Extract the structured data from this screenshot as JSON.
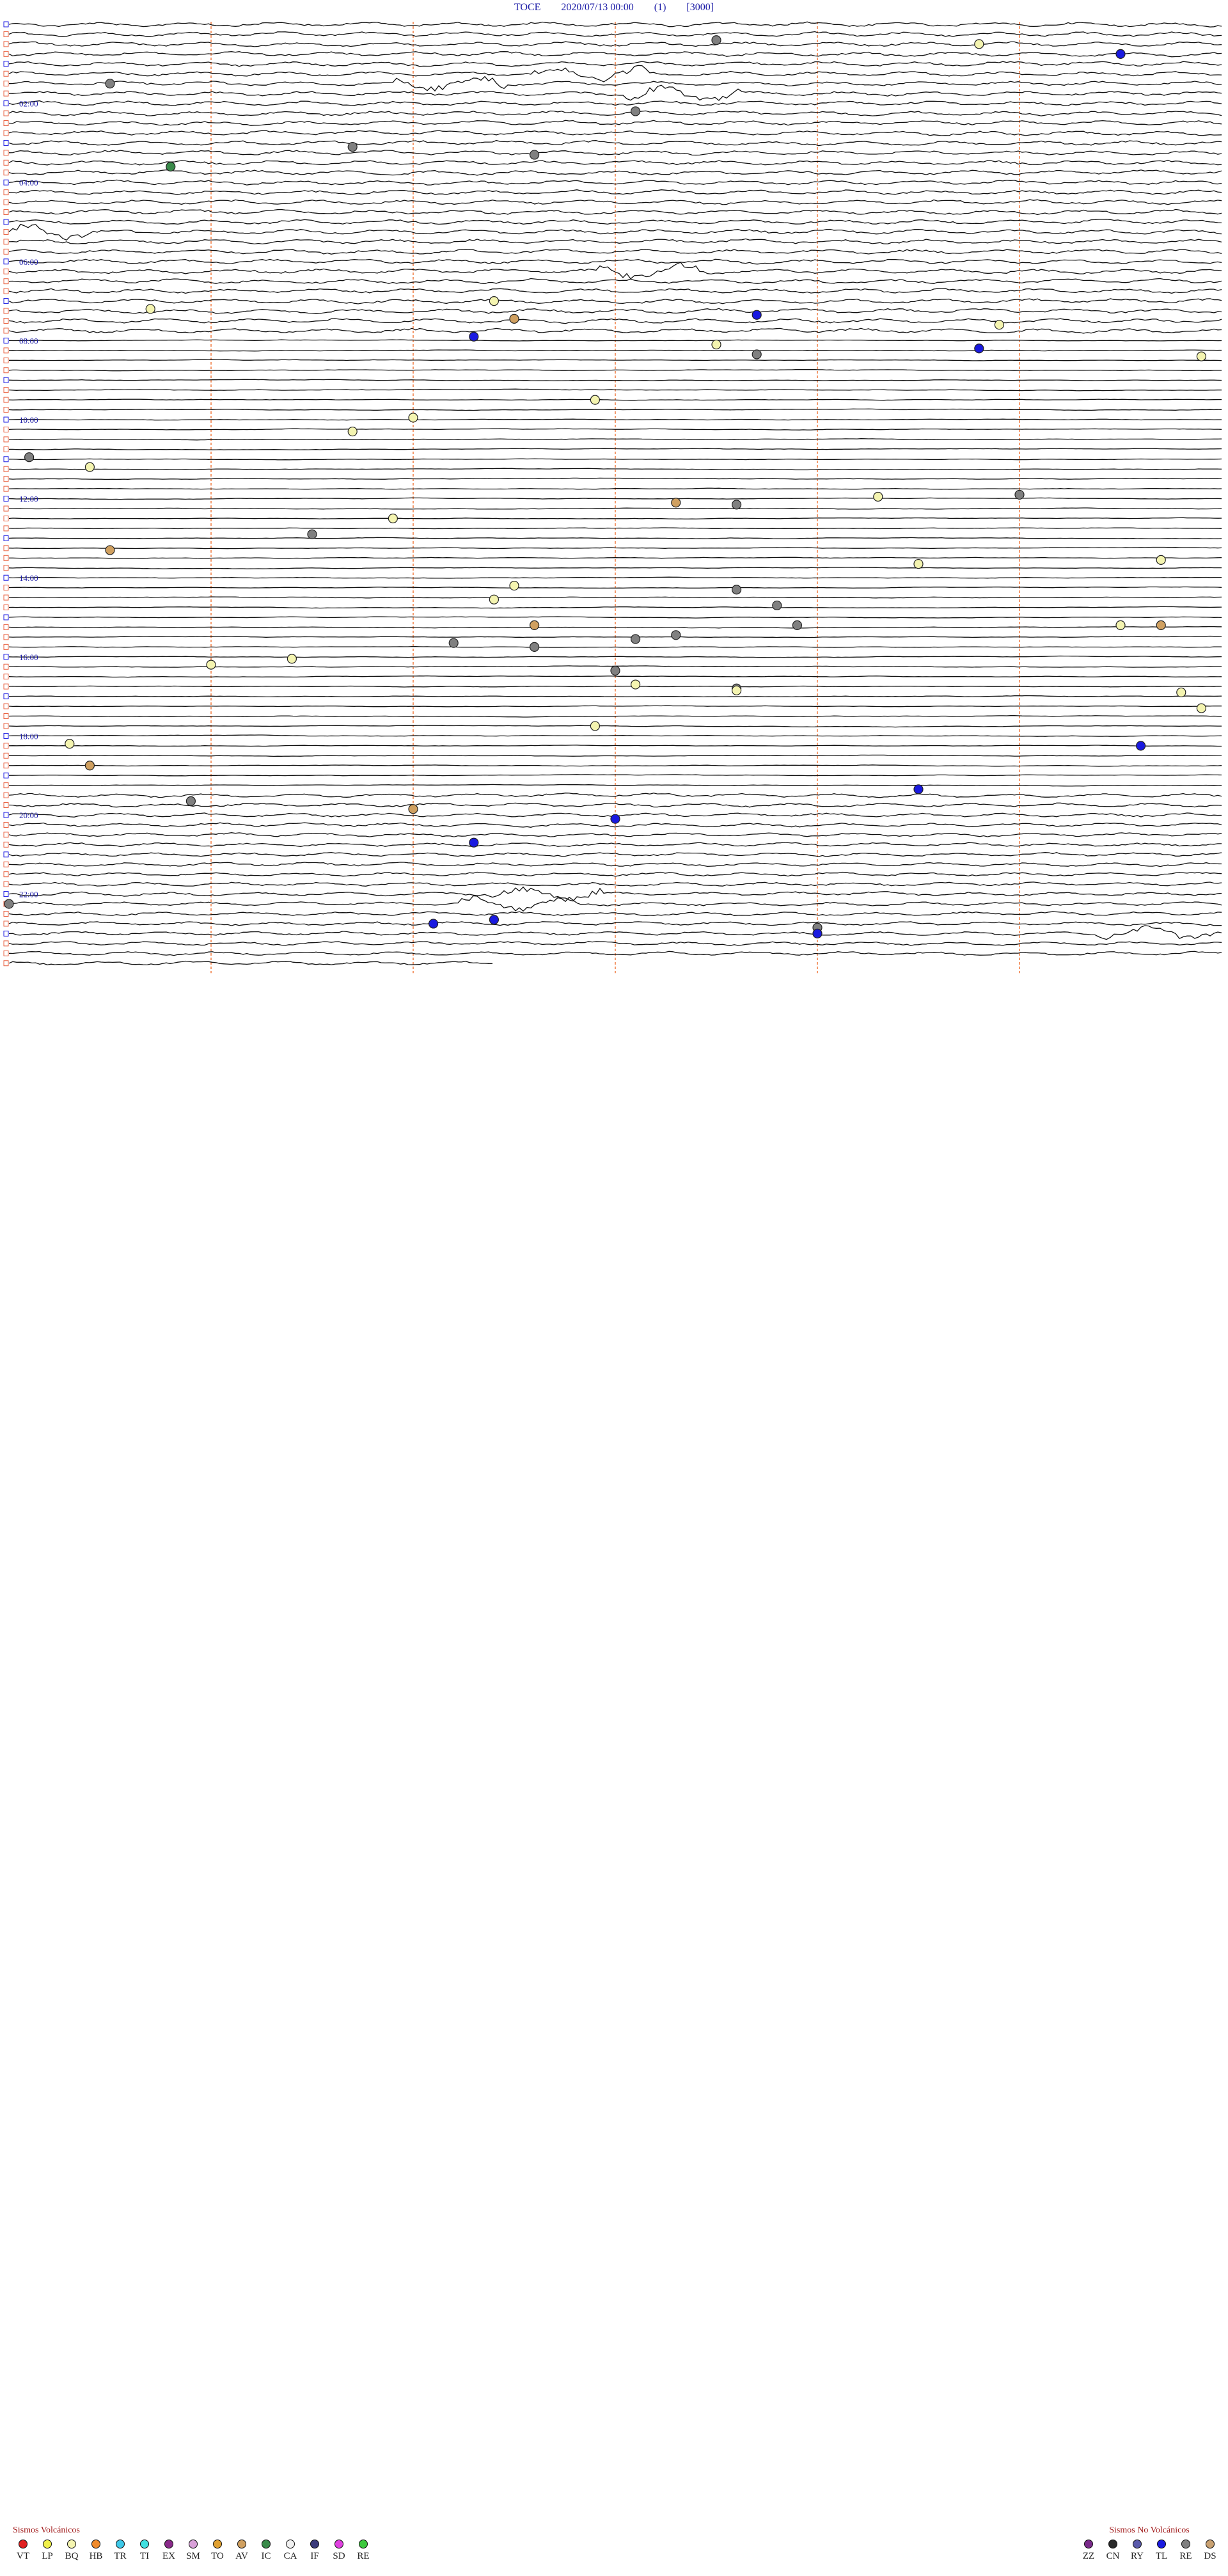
{
  "header": {
    "station": "TOCE",
    "datetime": "2020/07/13 00:00",
    "channel": "(1)",
    "scale": "[3000]"
  },
  "chart_data": {
    "type": "line",
    "title": "TOCE 2020/07/13 00:00 (1) [3000]",
    "hour_labels": [
      "02:00",
      "04:00",
      "06:00",
      "08:00",
      "10:00",
      "12:00",
      "14:00",
      "16:00",
      "18:00",
      "20:00",
      "22:00"
    ],
    "hour_label_hours": [
      2,
      4,
      6,
      8,
      10,
      12,
      14,
      16,
      18,
      20,
      22
    ],
    "total_hours": 24,
    "lines_per_hour": 4,
    "minute_markers": [
      10,
      20,
      30,
      40,
      50
    ],
    "events": [
      {
        "hour": 0.4,
        "minute": 35,
        "type": "RE"
      },
      {
        "hour": 0.5,
        "minute": 48,
        "type": "BQ"
      },
      {
        "hour": 0.75,
        "minute": 55,
        "type": "TL"
      },
      {
        "hour": 1.5,
        "minute": 5,
        "type": "RE"
      },
      {
        "hour": 2.2,
        "minute": 31,
        "type": "RE"
      },
      {
        "hour": 3.1,
        "minute": 17,
        "type": "RE"
      },
      {
        "hour": 3.3,
        "minute": 26,
        "type": "RE"
      },
      {
        "hour": 3.6,
        "minute": 8,
        "type": "IC"
      },
      {
        "hour": 7.0,
        "minute": 24,
        "type": "BQ"
      },
      {
        "hour": 7.2,
        "minute": 7,
        "type": "BQ"
      },
      {
        "hour": 7.35,
        "minute": 37,
        "type": "TL"
      },
      {
        "hour": 7.45,
        "minute": 25,
        "type": "AV"
      },
      {
        "hour": 7.6,
        "minute": 49,
        "type": "BQ"
      },
      {
        "hour": 7.9,
        "minute": 23,
        "type": "TL"
      },
      {
        "hour": 8.1,
        "minute": 35,
        "type": "BQ"
      },
      {
        "hour": 8.2,
        "minute": 48,
        "type": "TL"
      },
      {
        "hour": 8.35,
        "minute": 37,
        "type": "RE"
      },
      {
        "hour": 8.4,
        "minute": 59,
        "type": "BQ"
      },
      {
        "hour": 9.5,
        "minute": 29,
        "type": "BQ"
      },
      {
        "hour": 9.95,
        "minute": 20,
        "type": "BQ"
      },
      {
        "hour": 10.3,
        "minute": 17,
        "type": "BQ"
      },
      {
        "hour": 10.95,
        "minute": 1,
        "type": "RE"
      },
      {
        "hour": 11.2,
        "minute": 4,
        "type": "BQ"
      },
      {
        "hour": 11.9,
        "minute": 50,
        "type": "RE"
      },
      {
        "hour": 11.95,
        "minute": 43,
        "type": "BQ"
      },
      {
        "hour": 12.1,
        "minute": 33,
        "type": "AV"
      },
      {
        "hour": 12.15,
        "minute": 36,
        "type": "RE"
      },
      {
        "hour": 12.5,
        "minute": 19,
        "type": "BQ"
      },
      {
        "hour": 12.9,
        "minute": 15,
        "type": "RE"
      },
      {
        "hour": 13.3,
        "minute": 5,
        "type": "AV"
      },
      {
        "hour": 13.55,
        "minute": 57,
        "type": "BQ"
      },
      {
        "hour": 13.65,
        "minute": 45,
        "type": "BQ"
      },
      {
        "hour": 14.2,
        "minute": 25,
        "type": "BQ"
      },
      {
        "hour": 14.3,
        "minute": 36,
        "type": "RE"
      },
      {
        "hour": 14.55,
        "minute": 24,
        "type": "BQ"
      },
      {
        "hour": 14.7,
        "minute": 38,
        "type": "RE"
      },
      {
        "hour": 15.2,
        "minute": 26,
        "type": "AV"
      },
      {
        "hour": 15.2,
        "minute": 39,
        "type": "RE"
      },
      {
        "hour": 15.2,
        "minute": 55,
        "type": "BQ"
      },
      {
        "hour": 15.2,
        "minute": 57,
        "type": "AV"
      },
      {
        "hour": 15.45,
        "minute": 33,
        "type": "RE"
      },
      {
        "hour": 15.55,
        "minute": 31,
        "type": "RE"
      },
      {
        "hour": 15.65,
        "minute": 22,
        "type": "RE"
      },
      {
        "hour": 15.75,
        "minute": 26,
        "type": "RE"
      },
      {
        "hour": 16.05,
        "minute": 14,
        "type": "BQ"
      },
      {
        "hour": 16.2,
        "minute": 10,
        "type": "BQ"
      },
      {
        "hour": 16.35,
        "minute": 30,
        "type": "RE"
      },
      {
        "hour": 16.7,
        "minute": 31,
        "type": "BQ"
      },
      {
        "hour": 16.8,
        "minute": 36,
        "type": "RE"
      },
      {
        "hour": 16.85,
        "minute": 36,
        "type": "BQ"
      },
      {
        "hour": 16.9,
        "minute": 58,
        "type": "BQ"
      },
      {
        "hour": 17.3,
        "minute": 59,
        "type": "BQ"
      },
      {
        "hour": 17.75,
        "minute": 29,
        "type": "BQ"
      },
      {
        "hour": 18.2,
        "minute": 3,
        "type": "BQ"
      },
      {
        "hour": 18.25,
        "minute": 56,
        "type": "TL"
      },
      {
        "hour": 18.75,
        "minute": 4,
        "type": "AV"
      },
      {
        "hour": 19.35,
        "minute": 45,
        "type": "TL"
      },
      {
        "hour": 19.65,
        "minute": 9,
        "type": "RE"
      },
      {
        "hour": 19.85,
        "minute": 20,
        "type": "AV"
      },
      {
        "hour": 20.1,
        "minute": 30,
        "type": "TL"
      },
      {
        "hour": 20.7,
        "minute": 23,
        "type": "TL"
      },
      {
        "hour": 22.25,
        "minute": 0,
        "type": "RE"
      },
      {
        "hour": 22.65,
        "minute": 24,
        "type": "TL"
      },
      {
        "hour": 22.75,
        "minute": 21,
        "type": "TL"
      },
      {
        "hour": 22.85,
        "minute": 40,
        "type": "RE"
      },
      {
        "hour": 23.0,
        "minute": 40,
        "type": "TL"
      }
    ]
  },
  "legend_left": {
    "title": "Sismos Volcánicos",
    "items": [
      {
        "code": "VT",
        "color": "#e02020"
      },
      {
        "code": "LP",
        "color": "#f0f04a"
      },
      {
        "code": "BQ",
        "color": "#f4f4b0"
      },
      {
        "code": "HB",
        "color": "#f08a2a"
      },
      {
        "code": "TR",
        "color": "#3ec8e8"
      },
      {
        "code": "TI",
        "color": "#40e0e0"
      },
      {
        "code": "EX",
        "color": "#8a2a8a"
      },
      {
        "code": "SM",
        "color": "#d8a0d8"
      },
      {
        "code": "TO",
        "color": "#e0a030"
      },
      {
        "code": "AV",
        "color": "#d0a060"
      },
      {
        "code": "IC",
        "color": "#3a8a4a"
      },
      {
        "code": "CA",
        "color": "#f0f0f0"
      },
      {
        "code": "IF",
        "color": "#3a3a7a"
      },
      {
        "code": "SD",
        "color": "#e040e0"
      },
      {
        "code": "RE",
        "color": "#3ec83e"
      }
    ]
  },
  "legend_right": {
    "title": "Sismos No Volcánicos",
    "items": [
      {
        "code": "ZZ",
        "color": "#7a2a8a"
      },
      {
        "code": "CN",
        "color": "#2a2a2a"
      },
      {
        "code": "RY",
        "color": "#5a5aaa"
      },
      {
        "code": "TL",
        "color": "#1a1ae0"
      },
      {
        "code": "RE",
        "color": "#808080"
      },
      {
        "code": "DS",
        "color": "#c8a070"
      }
    ]
  }
}
